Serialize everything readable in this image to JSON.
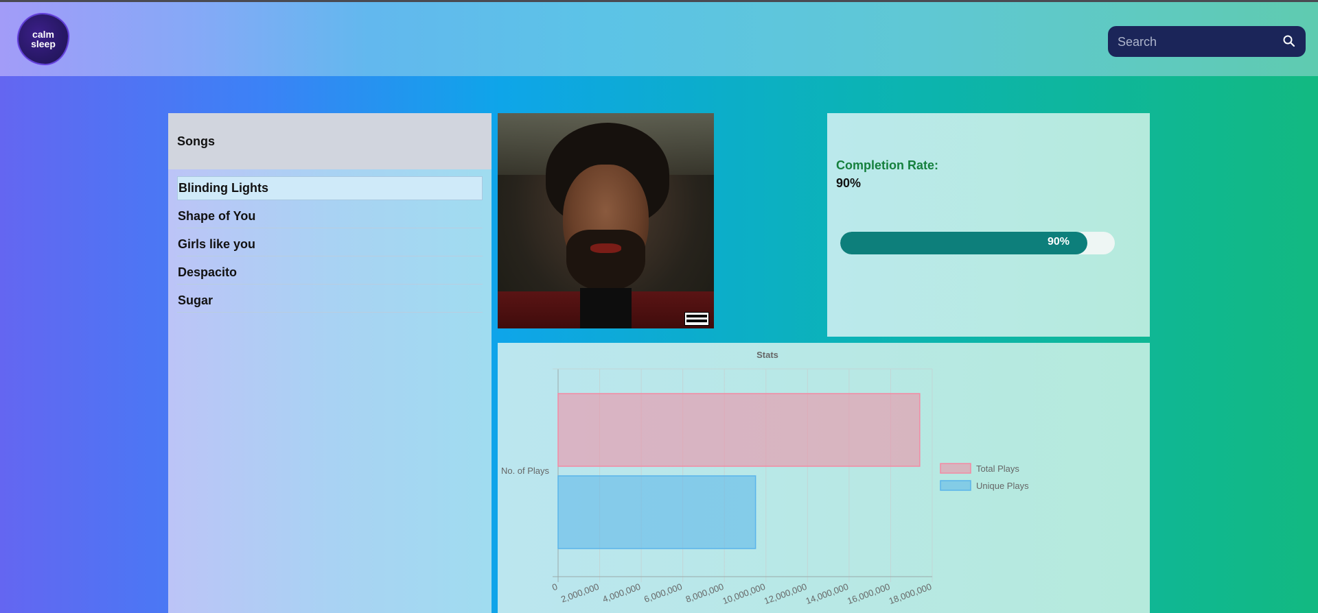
{
  "header": {
    "logo_line1": "calm",
    "logo_line2": "sleep",
    "search_placeholder": "Search",
    "search_icon": "search-icon"
  },
  "songs": {
    "title": "Songs",
    "items": [
      {
        "label": "Blinding Lights",
        "active": true
      },
      {
        "label": "Shape of You",
        "active": false
      },
      {
        "label": "Girls like you",
        "active": false
      },
      {
        "label": "Despacito",
        "active": false
      },
      {
        "label": "Sugar",
        "active": false
      }
    ]
  },
  "completion": {
    "label": "Completion Rate:",
    "value": "90%",
    "progress": 0.9,
    "progress_text": "90%",
    "colors": {
      "label": "#15803d",
      "bar": "#0d7f7b"
    }
  },
  "chart_data": {
    "type": "bar",
    "orientation": "horizontal",
    "title": "Stats",
    "categories": [
      "No. of Plays"
    ],
    "series": [
      {
        "name": "Total Plays",
        "values": [
          17400000
        ],
        "color": "#f38aa3"
      },
      {
        "name": "Unique Plays",
        "values": [
          9500000
        ],
        "color": "#5ab4ea"
      }
    ],
    "xlim": [
      0,
      18000000
    ],
    "x_ticks": [
      "0",
      "2,000,000",
      "4,000,000",
      "6,000,000",
      "8,000,000",
      "10,000,000",
      "12,000,000",
      "14,000,000",
      "16,000,000",
      "18,000,000"
    ],
    "legend_position": "right",
    "grid": true
  }
}
